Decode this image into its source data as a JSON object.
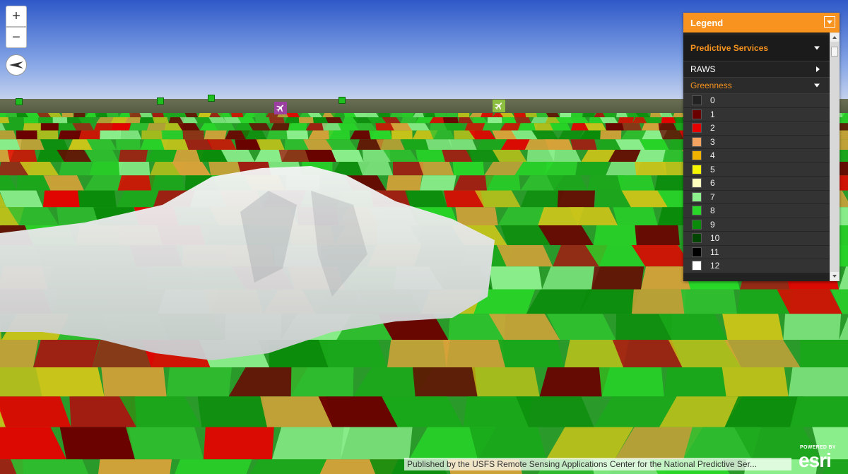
{
  "map": {
    "zoom_in_label": "+",
    "zoom_out_label": "−",
    "station_color": "#1fbf1f"
  },
  "legend": {
    "title": "Legend",
    "accent": "#f7931e",
    "sections": {
      "predictive": "Predictive Services",
      "raws": "RAWS",
      "greenness": "Greenness"
    },
    "items": [
      {
        "label": "0",
        "color": "#222222"
      },
      {
        "label": "1",
        "color": "#6b0000"
      },
      {
        "label": "2",
        "color": "#e60000"
      },
      {
        "label": "3",
        "color": "#f4a460"
      },
      {
        "label": "4",
        "color": "#f0b400"
      },
      {
        "label": "5",
        "color": "#f5f500"
      },
      {
        "label": "6",
        "color": "#ffffbe"
      },
      {
        "label": "7",
        "color": "#8cf08c"
      },
      {
        "label": "8",
        "color": "#28d728"
      },
      {
        "label": "9",
        "color": "#0a8c0a"
      },
      {
        "label": "10",
        "color": "#004600"
      },
      {
        "label": "11",
        "color": "#000000"
      },
      {
        "label": "12",
        "color": "#ffffff"
      }
    ]
  },
  "attribution": "Published by the USFS Remote Sensing Applications Center for the National Predictive Ser...",
  "esri": {
    "powered_by": "POWERED BY",
    "wordmark": "esri"
  },
  "icons": {
    "zoom_in": "plus-icon",
    "zoom_out": "minus-icon",
    "compass": "compass-icon",
    "airport": "airplane-icon",
    "station": "square-marker-icon"
  }
}
